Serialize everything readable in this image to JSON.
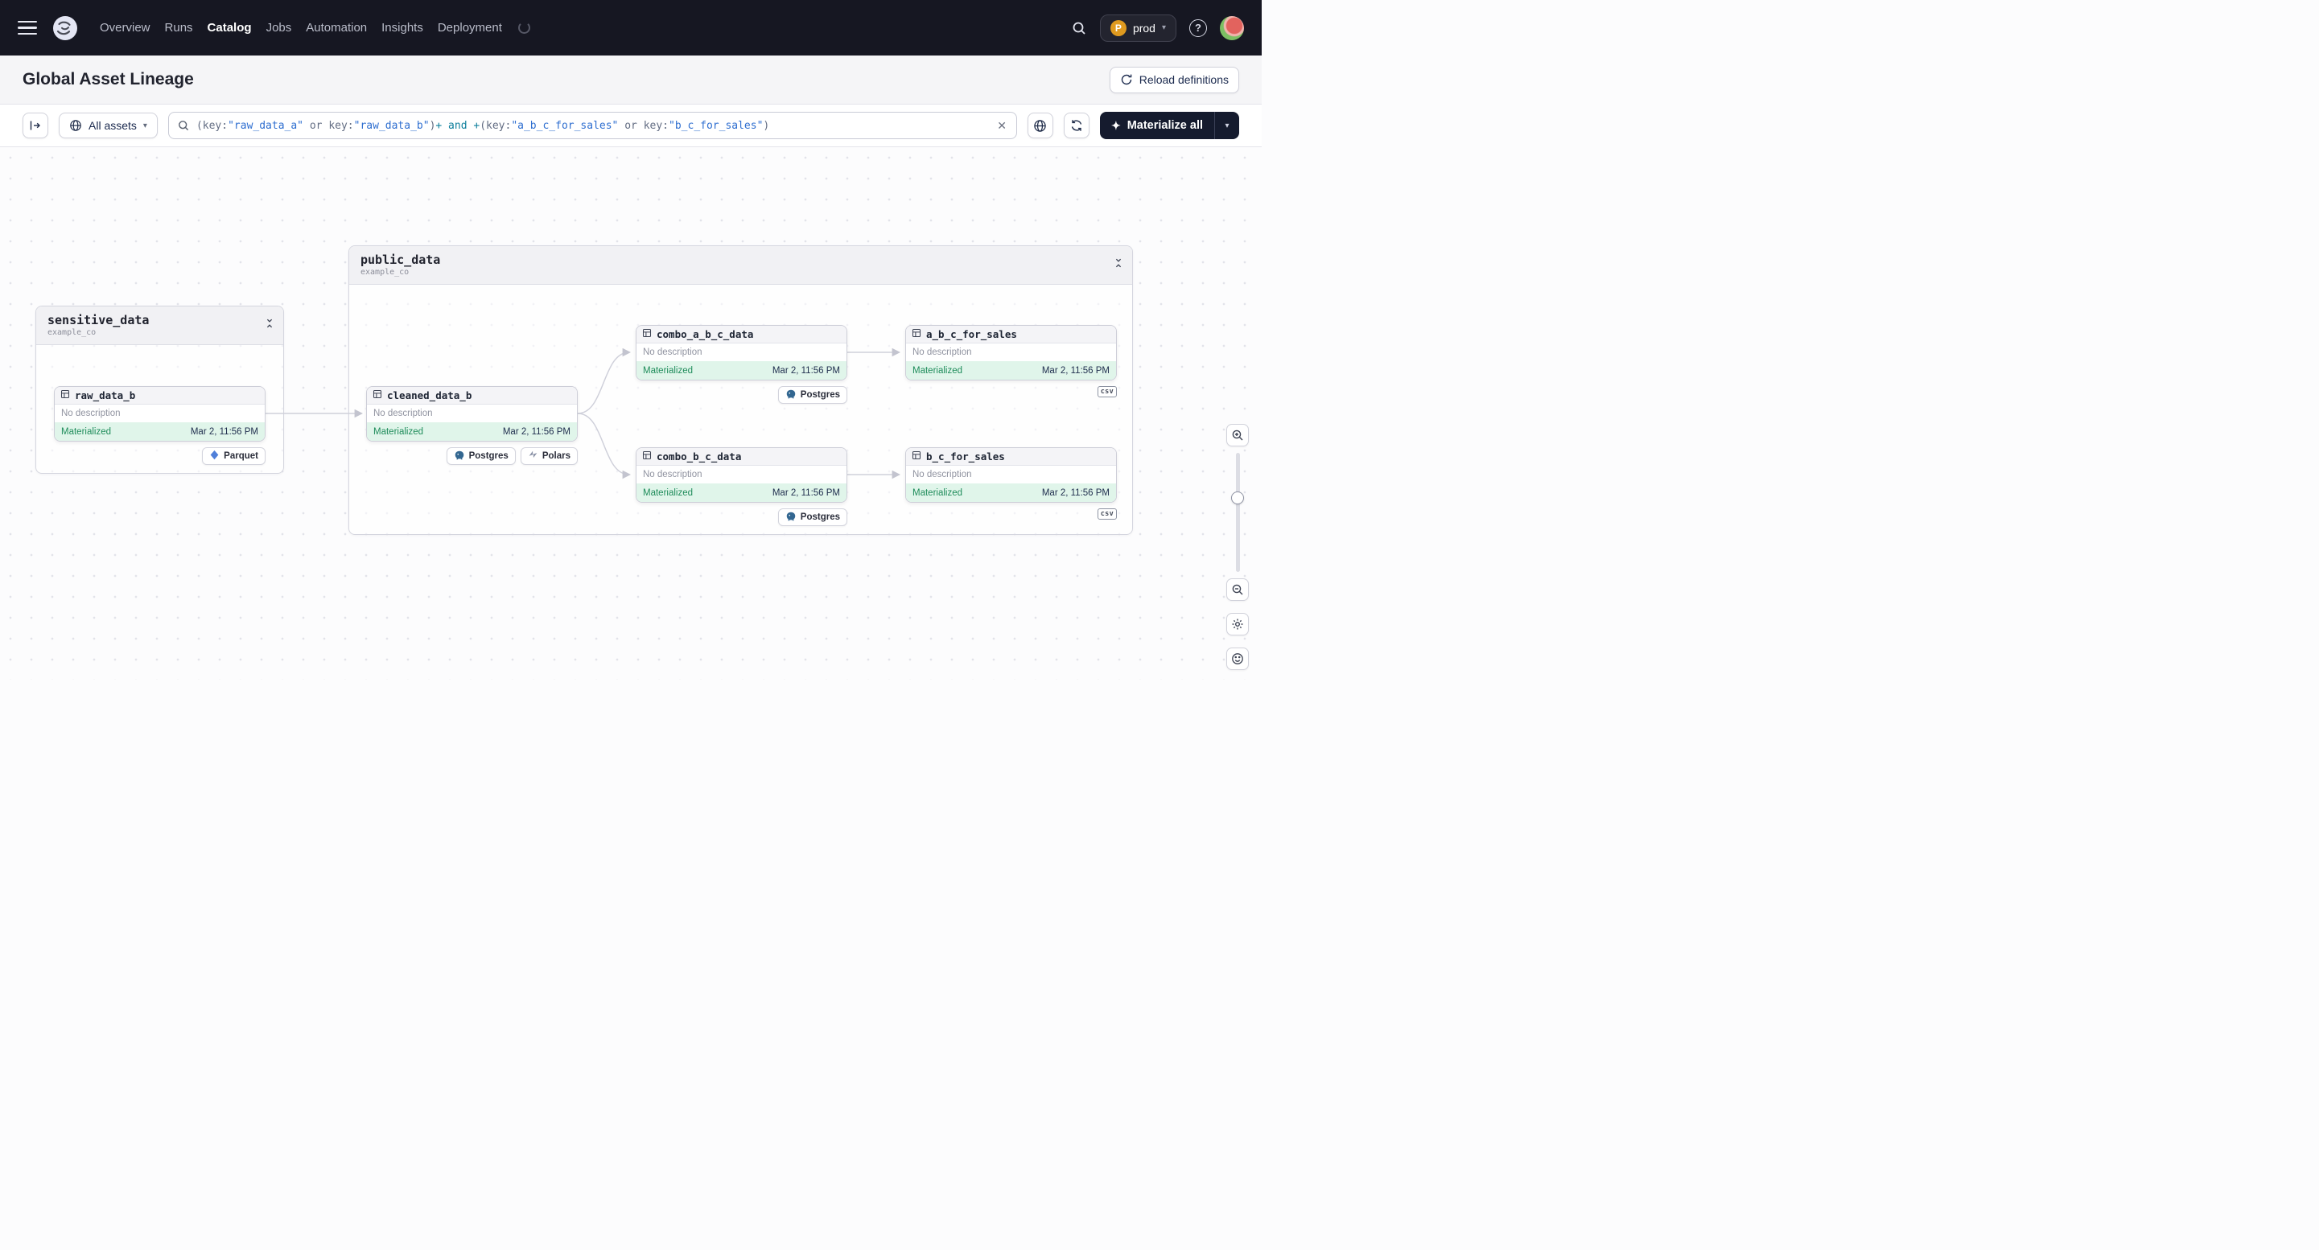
{
  "colors": {
    "nav_background": "#161722",
    "materialize_button": "#151b2e",
    "status_materialized_bg": "#e0f5ea",
    "status_materialized_text": "#1e8c5a",
    "query_string_token": "#2f6fd0",
    "query_operator_token": "#0e7f9c"
  },
  "icons": {
    "help": "?",
    "clear": "✕",
    "chevron_down": "▾",
    "sparkle": "✦"
  },
  "nav": {
    "items": [
      "Overview",
      "Runs",
      "Catalog",
      "Jobs",
      "Automation",
      "Insights",
      "Deployment"
    ],
    "active_item": "Catalog",
    "environment": {
      "initial": "P",
      "name": "prod"
    }
  },
  "page_header": {
    "title": "Global Asset Lineage",
    "reload_button_label": "Reload definitions"
  },
  "toolbar": {
    "scope_button_label": "All assets",
    "materialize_button_label": "Materialize all",
    "query_tokens": [
      "(key:",
      "\"raw_data_a\"",
      " or ",
      "key:",
      "\"raw_data_b\"",
      ")",
      "+ and +",
      "(key:",
      "\"a_b_c_for_sales\"",
      " or ",
      "key:",
      "\"b_c_for_sales\"",
      ")"
    ]
  },
  "lineage": {
    "groups": [
      {
        "name": "sensitive_data",
        "code_location": "example_co"
      },
      {
        "name": "public_data",
        "code_location": "example_co"
      }
    ],
    "nodes": [
      {
        "name": "raw_data_b",
        "description": "No description",
        "status": "Materialized",
        "materialized_at": "Mar 2, 11:56 PM"
      },
      {
        "name": "cleaned_data_b",
        "description": "No description",
        "status": "Materialized",
        "materialized_at": "Mar 2, 11:56 PM"
      },
      {
        "name": "combo_a_b_c_data",
        "description": "No description",
        "status": "Materialized",
        "materialized_at": "Mar 2, 11:56 PM"
      },
      {
        "name": "a_b_c_for_sales",
        "description": "No description",
        "status": "Materialized",
        "materialized_at": "Mar 2, 11:56 PM"
      },
      {
        "name": "combo_b_c_data",
        "description": "No description",
        "status": "Materialized",
        "materialized_at": "Mar 2, 11:56 PM"
      },
      {
        "name": "b_c_for_sales",
        "description": "No description",
        "status": "Materialized",
        "materialized_at": "Mar 2, 11:56 PM"
      }
    ],
    "tags": {
      "parquet": "Parquet",
      "postgres": "Postgres",
      "polars": "Polars",
      "csv": "csv"
    }
  }
}
